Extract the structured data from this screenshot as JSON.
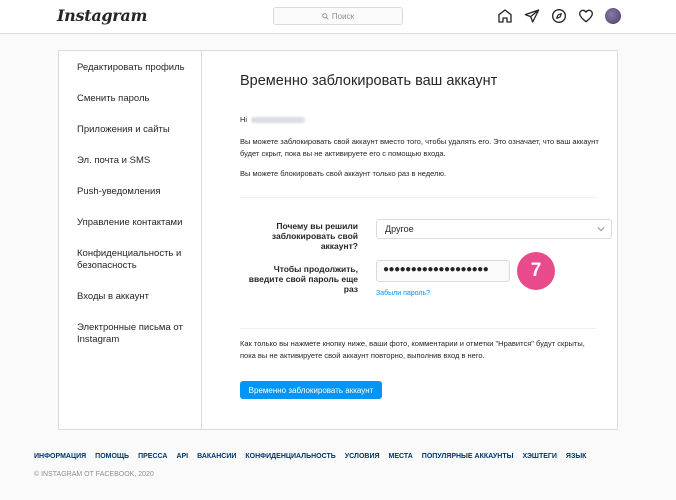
{
  "header": {
    "logo": "Instagram",
    "search_placeholder": "Поиск",
    "icons": [
      "home-icon",
      "direct-icon",
      "explore-icon",
      "heart-icon",
      "avatar"
    ]
  },
  "sidebar": {
    "items": [
      {
        "label": "Редактировать профиль"
      },
      {
        "label": "Сменить пароль"
      },
      {
        "label": "Приложения и сайты"
      },
      {
        "label": "Эл. почта и SMS"
      },
      {
        "label": "Push-уведомления"
      },
      {
        "label": "Управление контактами"
      },
      {
        "label": "Конфиденциальность и безопасность"
      },
      {
        "label": "Входы в аккаунт"
      },
      {
        "label": "Электронные письма от Instagram"
      }
    ]
  },
  "main": {
    "title": "Временно заблокировать ваш аккаунт",
    "greeting": "Hi",
    "paragraph1": "Вы можете заблокировать свой аккаунт вместо того, чтобы удалять его. Это означает, что ваш аккаунт будет скрыт, пока вы не активируете его с помощью входа.",
    "paragraph2": "Вы можете блокировать свой аккаунт только раз в неделю.",
    "reason_label": "Почему вы решили заблокировать свой аккаунт?",
    "reason_value": "Другое",
    "password_label": "Чтобы продолжить, введите свой пароль еще раз",
    "password_value": "●●●●●●●●●●●●●●●●●●●",
    "step_badge": "7",
    "forgot_link": "Забыли пароль?",
    "paragraph3": "Как только вы нажмете кнопку ниже, ваши фото, комментарии и отметки \"Нравится\" будут скрыты, пока вы не активируете свой аккаунт повторно, выполнив вход в него.",
    "submit_button": "Временно заблокировать аккаунт"
  },
  "footer": {
    "links": [
      "ИНФОРМАЦИЯ",
      "ПОМОЩЬ",
      "ПРЕССА",
      "API",
      "ВАКАНСИИ",
      "КОНФИДЕНЦИАЛЬНОСТЬ",
      "УСЛОВИЯ",
      "МЕСТА",
      "ПОПУЛЯРНЫЕ АККАУНТЫ",
      "ХЭШТЕГИ",
      "ЯЗЫК"
    ],
    "copyright": "© INSTAGRAM ОТ FACEBOOK, 2020"
  },
  "colors": {
    "accent": "#0095f6",
    "badge": "#e74b8b",
    "border": "#dbdbdb",
    "background": "#fafafa"
  }
}
